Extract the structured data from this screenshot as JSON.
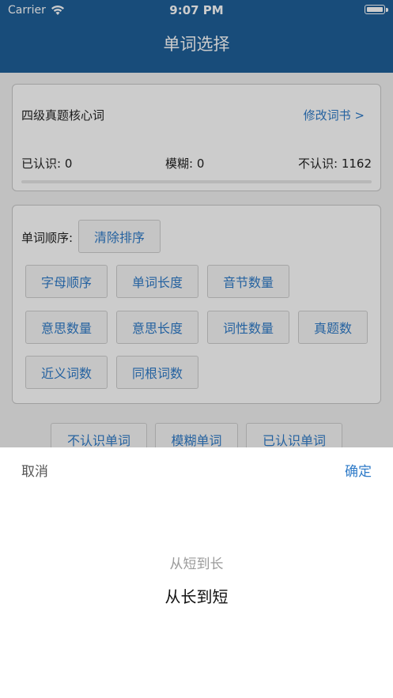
{
  "status_bar": {
    "carrier": "Carrier",
    "time": "9:07 PM"
  },
  "nav": {
    "title": "单词选择"
  },
  "book": {
    "name": "四级真题核心词",
    "modify_label": "修改词书 >",
    "known": "已认识: 0",
    "fuzzy": "模糊: 0",
    "unknown": "不认识: 1162"
  },
  "order": {
    "label": "单词顺序:",
    "clear_label": "清除排序",
    "buttons": [
      "字母顺序",
      "单词长度",
      "音节数量",
      "意思数量",
      "意思长度",
      "词性数量",
      "真题数",
      "近义词数",
      "同根词数"
    ]
  },
  "filters": [
    "不认识单词",
    "模糊单词",
    "已认识单词"
  ],
  "picker": {
    "cancel": "取消",
    "confirm": "确定",
    "options": [
      "从短到长",
      "从长到短"
    ]
  }
}
